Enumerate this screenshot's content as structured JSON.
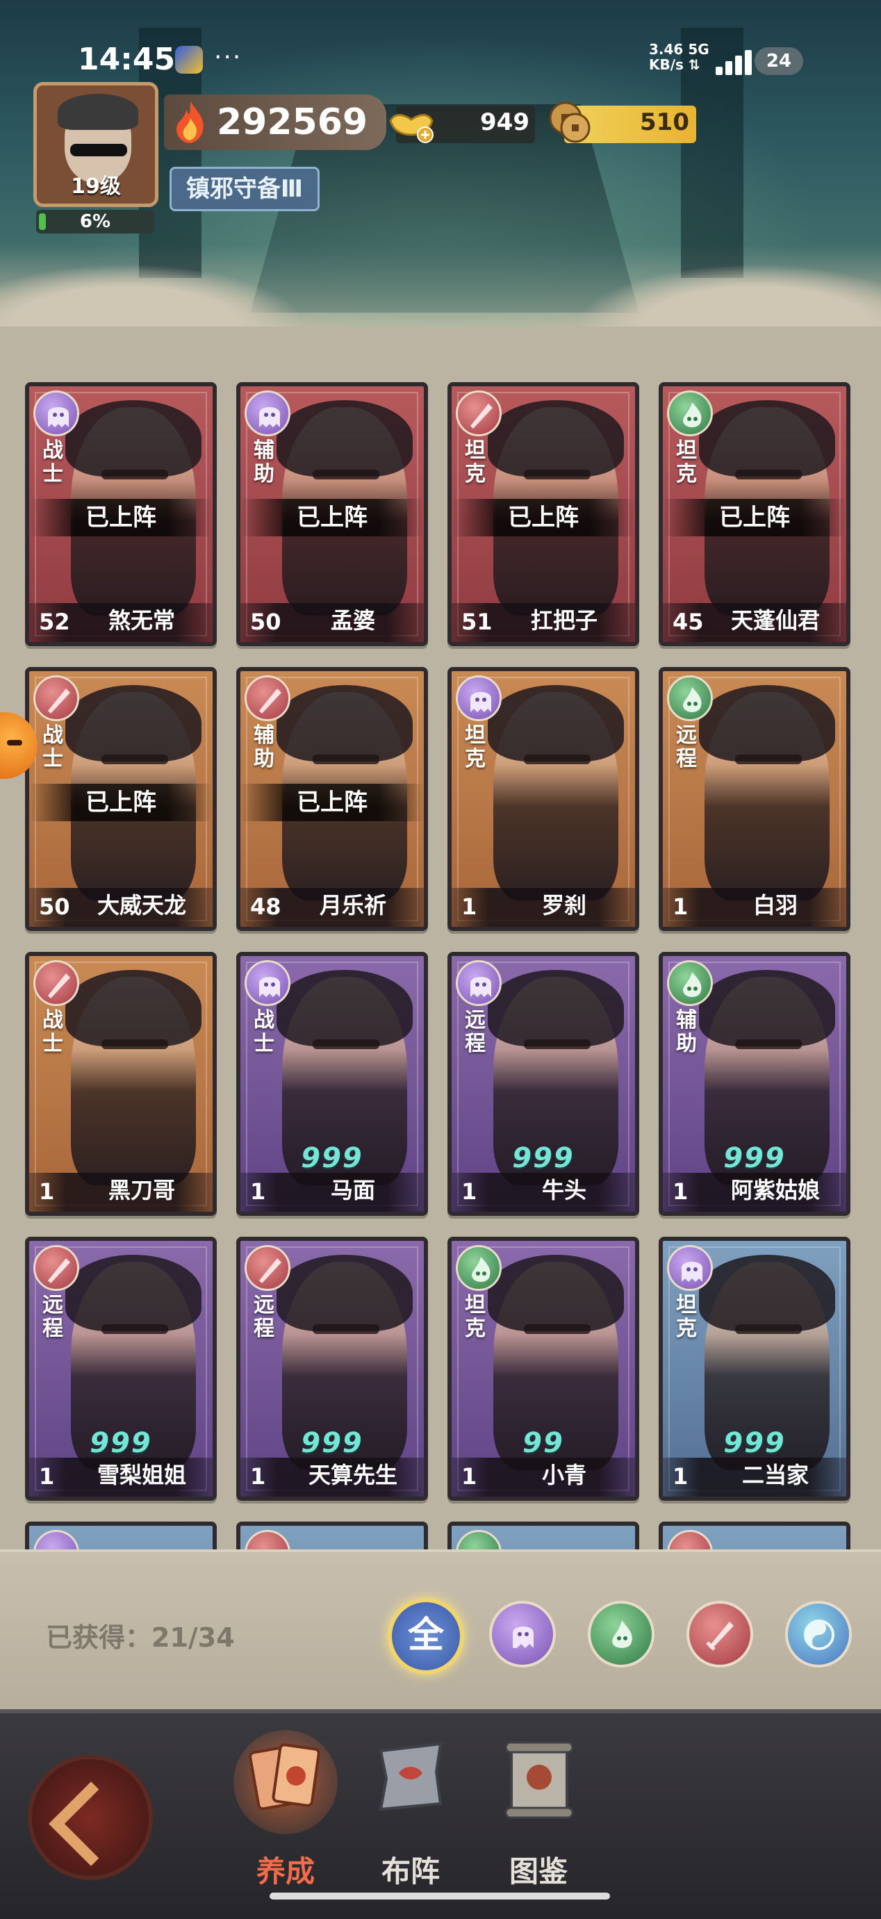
{
  "status": {
    "time": "14:45",
    "speed_value": "3.46",
    "speed_unit": "KB/s",
    "network": "5G",
    "battery": "24"
  },
  "player": {
    "level_label": "19级",
    "exp_percent_text": "6%",
    "exp_fraction": 0.06,
    "power": "292569",
    "title": "镇邪守备Ⅲ",
    "gold": "949",
    "coins": "510"
  },
  "cards": [
    {
      "faction": "ghost",
      "role": "战士",
      "deployed": "已上阵",
      "stars": "",
      "level": "52",
      "name": "煞无常",
      "color": "red"
    },
    {
      "faction": "ghost",
      "role": "辅助",
      "deployed": "已上阵",
      "stars": "",
      "level": "50",
      "name": "孟婆",
      "color": "red"
    },
    {
      "faction": "blade",
      "role": "坦克",
      "deployed": "已上阵",
      "stars": "",
      "level": "51",
      "name": "扛把子",
      "color": "red"
    },
    {
      "faction": "green",
      "role": "坦克",
      "deployed": "已上阵",
      "stars": "",
      "level": "45",
      "name": "天蓬仙君",
      "color": "red"
    },
    {
      "faction": "blade",
      "role": "战士",
      "deployed": "已上阵",
      "stars": "",
      "level": "50",
      "name": "大威天龙",
      "color": "orange"
    },
    {
      "faction": "blade",
      "role": "辅助",
      "deployed": "已上阵",
      "stars": "",
      "level": "48",
      "name": "月乐祈",
      "color": "orange"
    },
    {
      "faction": "ghost",
      "role": "坦克",
      "deployed": "",
      "stars": "",
      "level": "1",
      "name": "罗刹",
      "color": "orange"
    },
    {
      "faction": "green",
      "role": "远程",
      "deployed": "",
      "stars": "",
      "level": "1",
      "name": "白羽",
      "color": "orange"
    },
    {
      "faction": "blade",
      "role": "战士",
      "deployed": "",
      "stars": "",
      "level": "1",
      "name": "黑刀哥",
      "color": "orange"
    },
    {
      "faction": "ghost",
      "role": "战士",
      "deployed": "",
      "stars": "999",
      "level": "1",
      "name": "马面",
      "color": "purple"
    },
    {
      "faction": "ghost",
      "role": "远程",
      "deployed": "",
      "stars": "999",
      "level": "1",
      "name": "牛头",
      "color": "purple"
    },
    {
      "faction": "green",
      "role": "辅助",
      "deployed": "",
      "stars": "999",
      "level": "1",
      "name": "阿紫姑娘",
      "color": "purple"
    },
    {
      "faction": "blade",
      "role": "远程",
      "deployed": "",
      "stars": "999",
      "level": "1",
      "name": "雪梨姐姐",
      "color": "purple"
    },
    {
      "faction": "blade",
      "role": "远程",
      "deployed": "",
      "stars": "999",
      "level": "1",
      "name": "天算先生",
      "color": "purple"
    },
    {
      "faction": "green",
      "role": "坦克",
      "deployed": "",
      "stars": "99",
      "level": "1",
      "name": "小青",
      "color": "purple"
    },
    {
      "faction": "ghost",
      "role": "坦克",
      "deployed": "",
      "stars": "999",
      "level": "1",
      "name": "二当家",
      "color": "blue"
    }
  ],
  "filter": {
    "obtained": "已获得：21/34",
    "all_label": "全"
  },
  "nav": {
    "develop": "养成",
    "formation": "布阵",
    "codex": "图鉴"
  },
  "colors": {
    "accent_active": "#f26b4a",
    "star_teal": "#74e6d6",
    "coin_yellow": "#e8b431"
  }
}
